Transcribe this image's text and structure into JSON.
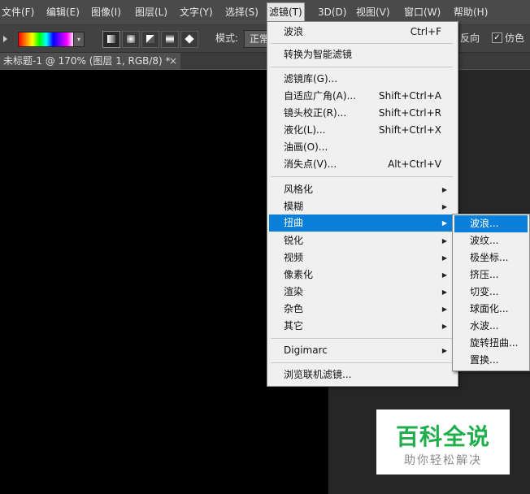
{
  "menubar": {
    "items": [
      {
        "label": "文件(F)"
      },
      {
        "label": "编辑(E)"
      },
      {
        "label": "图像(I)"
      },
      {
        "label": "图层(L)"
      },
      {
        "label": "文字(Y)"
      },
      {
        "label": "选择(S)"
      },
      {
        "label": "滤镜(T)",
        "active": true
      },
      {
        "label": "3D(D)"
      },
      {
        "label": "视图(V)"
      },
      {
        "label": "窗口(W)"
      },
      {
        "label": "帮助(H)"
      }
    ]
  },
  "options": {
    "mode_label": "模式:",
    "mode_value": "正常",
    "reverse_label": "反向",
    "dither_label": "仿色",
    "reverse_checked": true,
    "dither_checked": true,
    "gradient_icon": "gradient-swatch"
  },
  "document": {
    "tab_title": "未标题-1 @ 170% (图层 1, RGB/8) *",
    "close_glyph": "×"
  },
  "filter_menu": {
    "last_filter": {
      "label": "波浪",
      "shortcut": "Ctrl+F"
    },
    "convert_smart": {
      "label": "转换为智能滤镜"
    },
    "group1": [
      {
        "label": "滤镜库(G)...",
        "shortcut": ""
      },
      {
        "label": "自适应广角(A)...",
        "shortcut": "Shift+Ctrl+A"
      },
      {
        "label": "镜头校正(R)...",
        "shortcut": "Shift+Ctrl+R"
      },
      {
        "label": "液化(L)...",
        "shortcut": "Shift+Ctrl+X"
      },
      {
        "label": "油画(O)...",
        "shortcut": ""
      },
      {
        "label": "消失点(V)...",
        "shortcut": "Alt+Ctrl+V"
      }
    ],
    "group2": [
      {
        "label": "风格化"
      },
      {
        "label": "模糊"
      },
      {
        "label": "扭曲",
        "highlighted": true
      },
      {
        "label": "锐化"
      },
      {
        "label": "视频"
      },
      {
        "label": "像素化"
      },
      {
        "label": "渲染"
      },
      {
        "label": "杂色"
      },
      {
        "label": "其它"
      }
    ],
    "digimarc": {
      "label": "Digimarc"
    },
    "browse_online": {
      "label": "浏览联机滤镜..."
    }
  },
  "distort_submenu": {
    "items": [
      {
        "label": "波浪...",
        "highlighted": true
      },
      {
        "label": "波纹..."
      },
      {
        "label": "极坐标..."
      },
      {
        "label": "挤压..."
      },
      {
        "label": "切变..."
      },
      {
        "label": "球面化..."
      },
      {
        "label": "水波..."
      },
      {
        "label": "旋转扭曲..."
      },
      {
        "label": "置换..."
      }
    ]
  },
  "watermark": {
    "title": "百科全说",
    "subtitle": "助你轻松解决"
  },
  "colors": {
    "highlight": "#0a7fd9",
    "watermark_green": "#1fae4b"
  }
}
